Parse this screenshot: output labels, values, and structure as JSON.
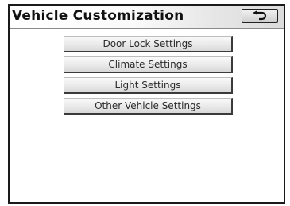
{
  "header": {
    "title": "Vehicle Customization",
    "back_icon": "back-arrow-icon"
  },
  "menu": {
    "items": [
      {
        "label": "Door Lock Settings"
      },
      {
        "label": "Climate Settings"
      },
      {
        "label": "Light Settings"
      },
      {
        "label": "Other Vehicle Settings"
      }
    ]
  },
  "colors": {
    "border": "#1a1a1a",
    "button_face": "#e9e9e9",
    "text": "#111111"
  }
}
